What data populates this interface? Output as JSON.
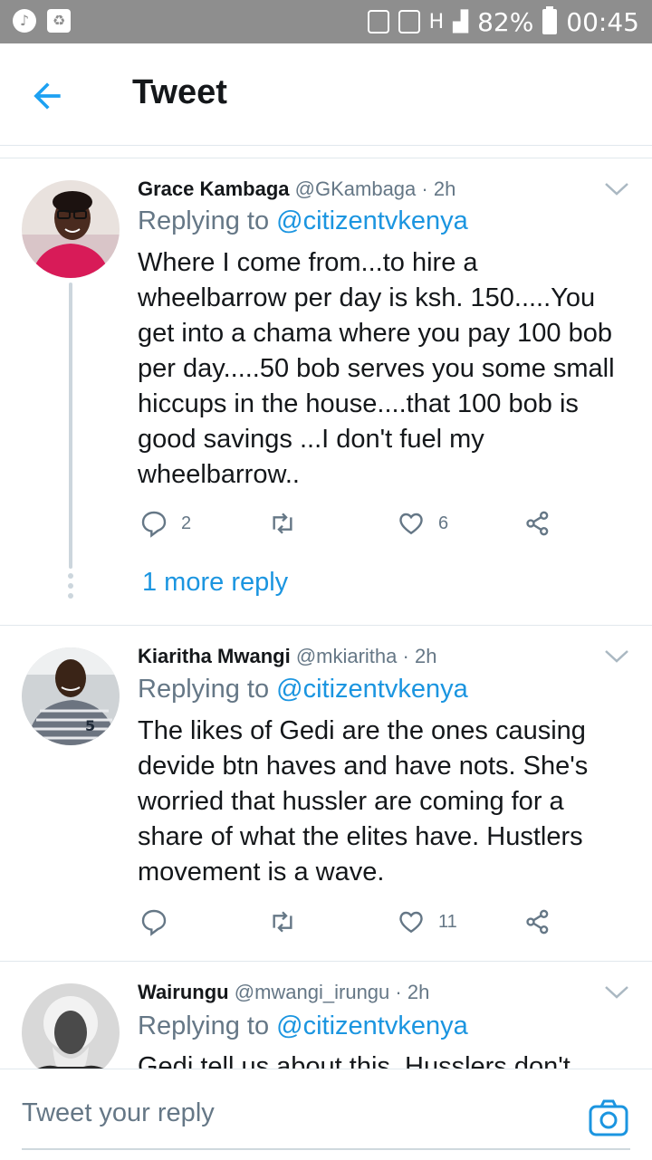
{
  "status_bar": {
    "battery": "82%",
    "time": "00:45",
    "network": "H"
  },
  "header": {
    "title": "Tweet"
  },
  "colors": {
    "accent": "#1b95e0",
    "text": "#14171a",
    "muted": "#657786",
    "divider": "#e1e8ed"
  },
  "tweets": [
    {
      "name": "Grace Kambaga",
      "handle": "@GKambaga",
      "time": "· 2h",
      "replying_prefix": "Replying to ",
      "replying_to": "@citizentvkenya",
      "text_lines": [
        "Where I come from...to hire a",
        "wheelbarrow per day is ksh. 150.....You",
        "get into a chama where you pay 100 bob",
        "per day.....50 bob serves you some small",
        "hiccups in the house....that 100 bob is",
        "good savings ...I don't fuel my",
        "wheelbarrow.."
      ],
      "replies": "2",
      "retweets": "",
      "likes": "6",
      "more_replies": "1 more reply"
    },
    {
      "name": "Kiaritha Mwangi",
      "handle": "@mkiaritha",
      "time": "· 2h",
      "replying_prefix": "Replying to ",
      "replying_to": "@citizentvkenya",
      "text_lines": [
        "The likes of Gedi are the ones causing",
        "devide btn haves and have nots. She's",
        "worried that hussler are coming for a",
        "share of what the elites have. Hustlers",
        "movement is a wave."
      ],
      "replies": "",
      "retweets": "",
      "likes": "11"
    },
    {
      "name": "Wairungu",
      "handle": "@mwangi_irungu",
      "time": "· 2h",
      "replying_prefix": "Replying to ",
      "replying_to": "@citizentvkenya",
      "text_lines": [
        "Gedi tell us about this. Husslers don't"
      ]
    }
  ],
  "compose": {
    "placeholder": "Tweet your reply"
  },
  "icons": [
    "back-arrow-icon",
    "chevron-down-icon",
    "reply-icon",
    "retweet-icon",
    "like-icon",
    "share-icon",
    "camera-icon"
  ]
}
